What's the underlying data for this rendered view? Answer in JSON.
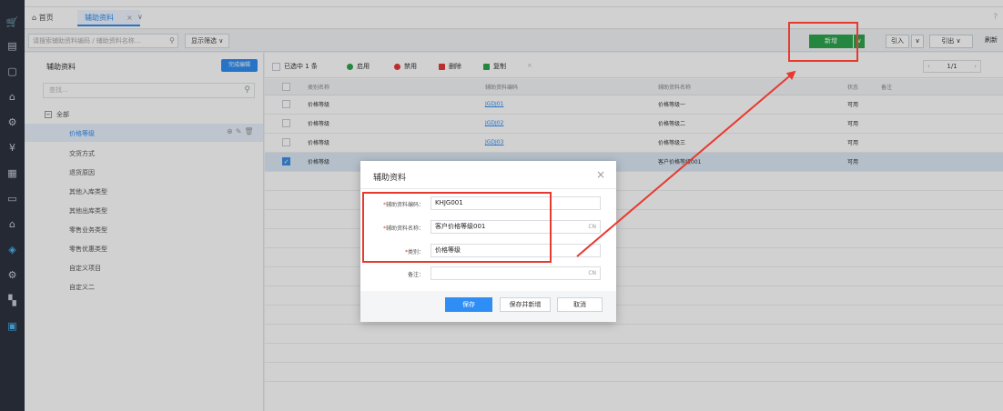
{
  "tabs": {
    "home": "首页",
    "active": "辅助资料"
  },
  "toolbar": {
    "search_placeholder": "请搜索辅助资料编码 / 辅助资料名称...",
    "filter_label": "显示筛选",
    "new_label": "新增",
    "import_label": "引入",
    "export_label": "引出",
    "refresh_label": "刷新"
  },
  "leftpanel": {
    "title": "辅助资料",
    "done_label": "完成编辑",
    "search_placeholder": "查找...",
    "root": "全部",
    "items": [
      "价格等级",
      "交货方式",
      "退货原因",
      "其他入库类型",
      "其他出库类型",
      "零售业务类型",
      "零售优惠类型",
      "自定义项目",
      "自定义二"
    ]
  },
  "actions": {
    "selected": "已选中 1 条",
    "enable": "启用",
    "disable": "禁用",
    "delete": "删除",
    "copy": "复制",
    "pager": "1/1"
  },
  "colors": {
    "accent": "#2f8ef5",
    "green": "#2da44e",
    "red": "#e8392f"
  },
  "table": {
    "headers": [
      "类别名称",
      "辅助资料编码",
      "辅助资料名称",
      "状态",
      "备注"
    ],
    "rows": [
      {
        "category": "价格等级",
        "code": "JGDJ01",
        "name": "价格等级一",
        "status": "可用",
        "checked": false
      },
      {
        "category": "价格等级",
        "code": "JGDJ02",
        "name": "价格等级二",
        "status": "可用",
        "checked": false
      },
      {
        "category": "价格等级",
        "code": "JGDJ03",
        "name": "价格等级三",
        "status": "可用",
        "checked": false
      },
      {
        "category": "价格等级",
        "code": "",
        "name": "客户价格等级001",
        "status": "可用",
        "checked": true
      }
    ]
  },
  "modal": {
    "title": "辅助资料",
    "code_label": "辅助资料编码：",
    "code_value": "KHJG001",
    "name_label": "辅助资料名称：",
    "name_value": "客户价格等级001",
    "category_label": "类别：",
    "category_value": "价格等级",
    "note_label": "备注：",
    "note_value": "",
    "cn": "CN",
    "save": "保存",
    "save_new": "保存并新增",
    "cancel": "取消"
  }
}
